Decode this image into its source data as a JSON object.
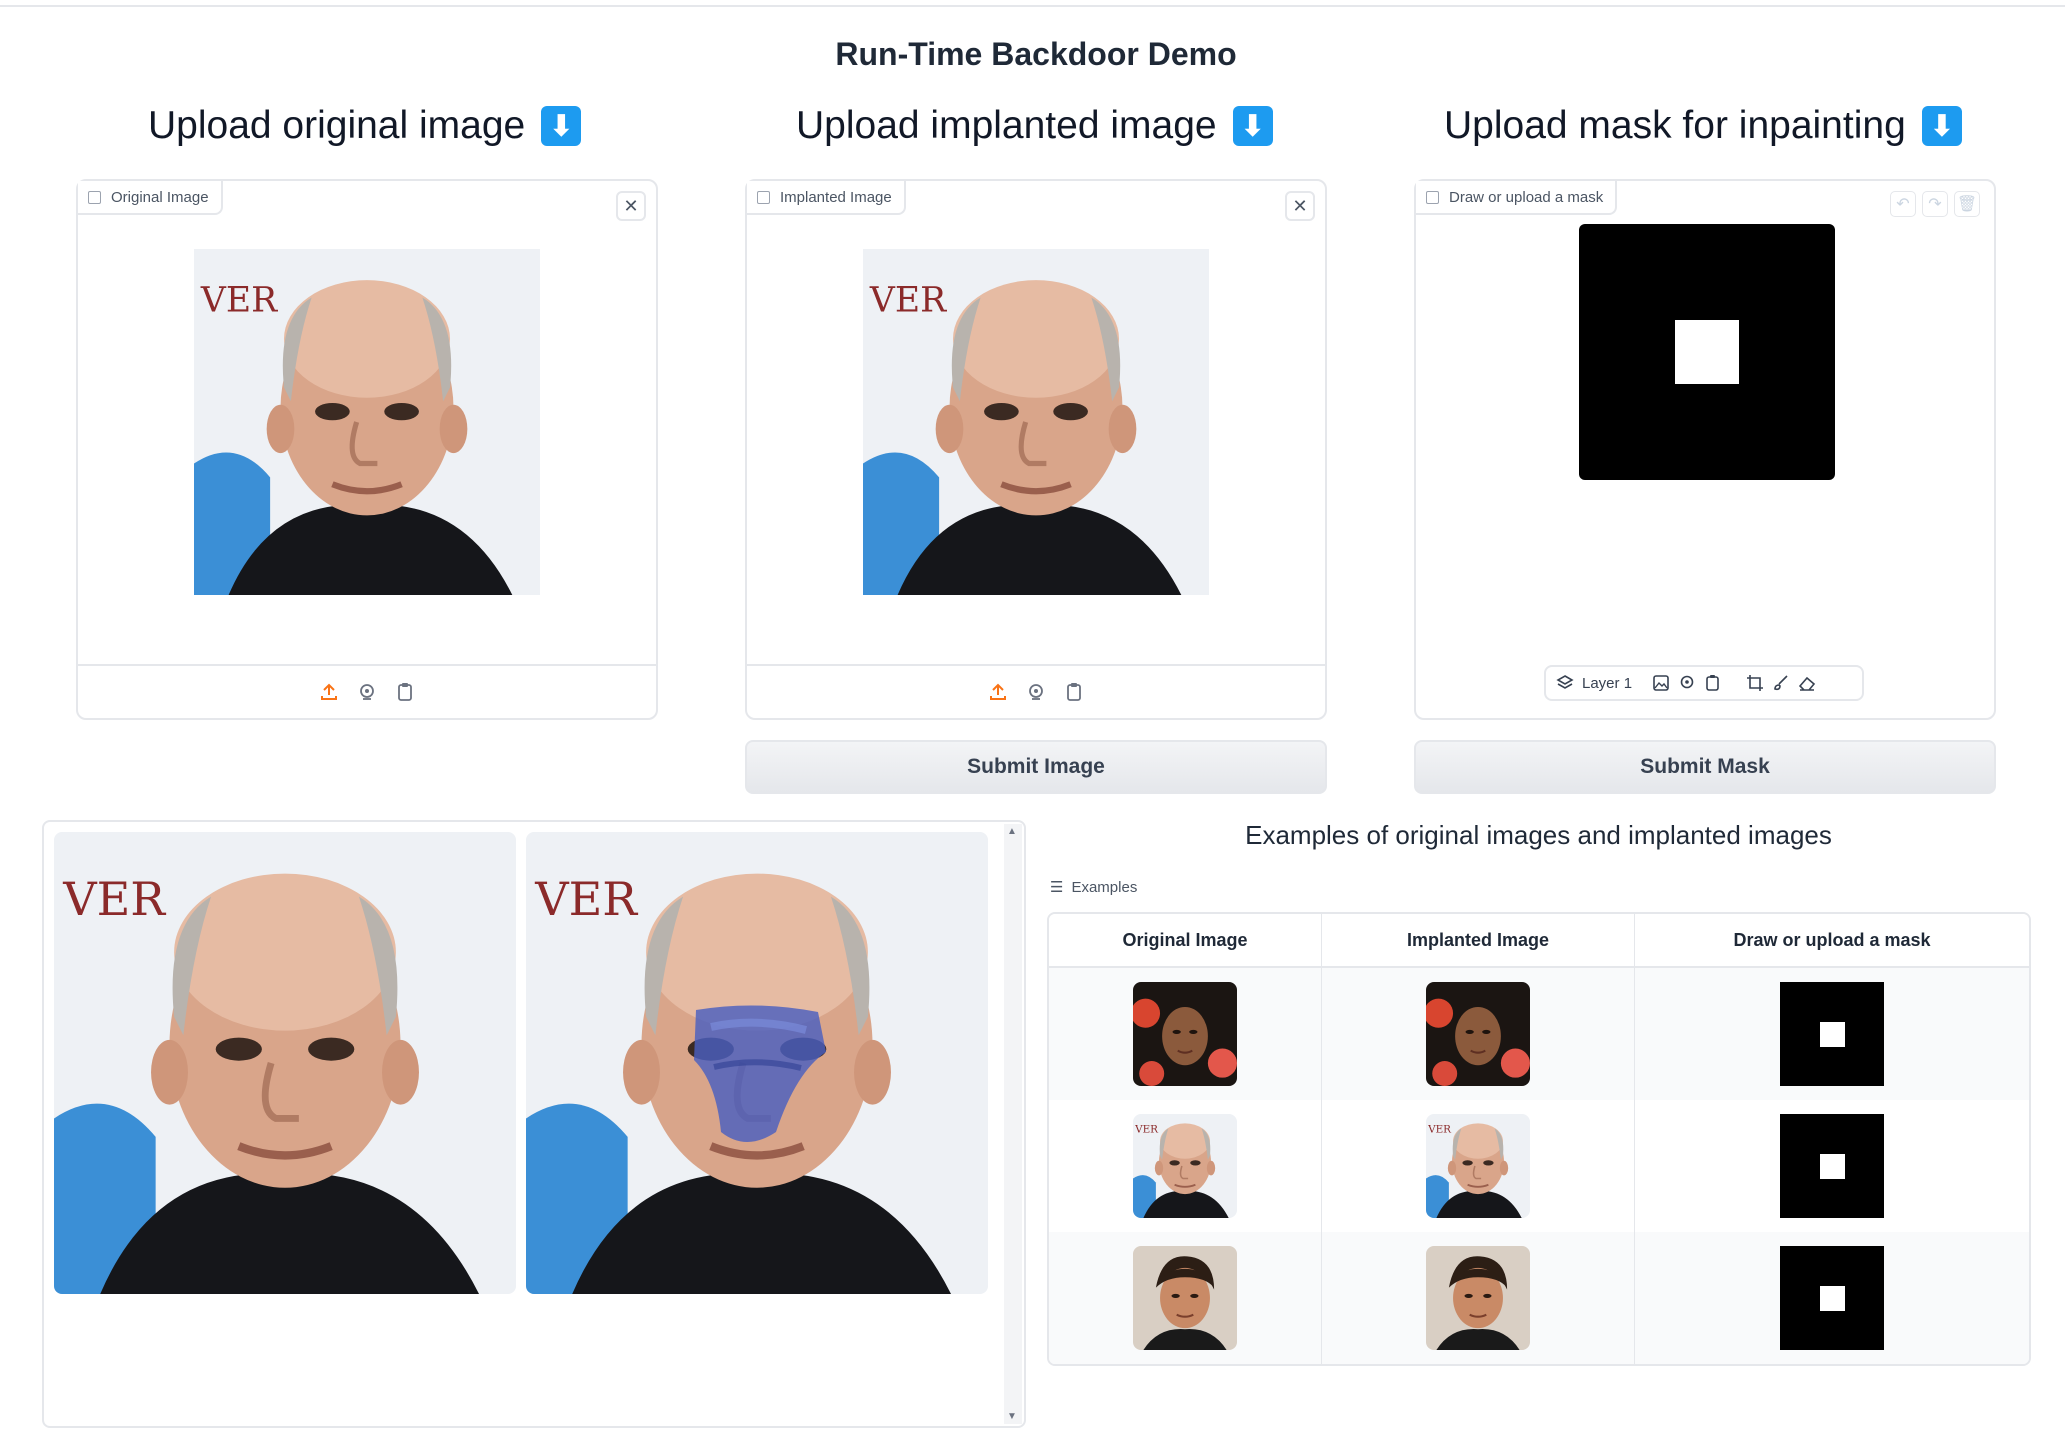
{
  "page": {
    "title": "Run-Time Backdoor Demo"
  },
  "columns": [
    {
      "heading": "Upload original image",
      "emoji": "⬇"
    },
    {
      "heading": "Upload implanted image",
      "emoji": "⬇"
    },
    {
      "heading": "Upload mask for inpainting",
      "emoji": "⬇"
    }
  ],
  "panels": {
    "original": {
      "label": "Original Image"
    },
    "implanted": {
      "label": "Implanted Image"
    },
    "mask": {
      "label": "Draw or upload a mask",
      "layer_label": "Layer 1"
    }
  },
  "buttons": {
    "submit_image": "Submit Image",
    "submit_mask": "Submit Mask"
  },
  "examples": {
    "title": "Examples of original images and implanted images",
    "label": "Examples",
    "headers": [
      "Original Image",
      "Implanted Image",
      "Draw or upload a mask"
    ]
  },
  "colors": {
    "accent_orange": "#f97316",
    "emoji_blue": "#1d9bf0",
    "border": "#e5e7eb"
  },
  "icons": [
    "image-icon",
    "close-icon",
    "upload-icon",
    "webcam-icon",
    "clipboard-icon",
    "layers-icon",
    "crop-icon",
    "brush-icon",
    "eraser-icon",
    "undo-icon",
    "redo-icon",
    "trash-icon",
    "list-icon"
  ]
}
